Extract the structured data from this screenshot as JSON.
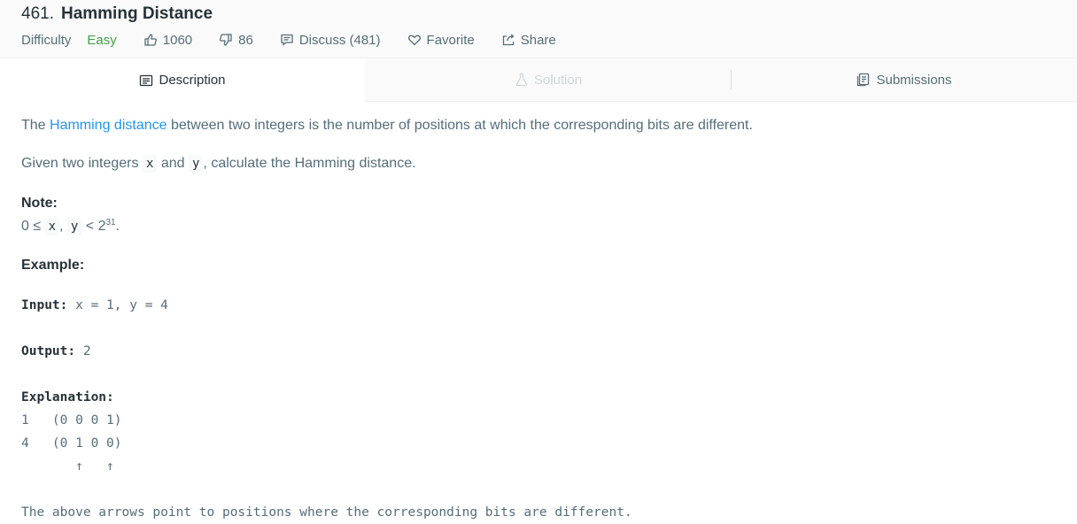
{
  "problem": {
    "number": "461.",
    "title": "Hamming Distance"
  },
  "meta": {
    "difficulty_label": "Difficulty",
    "difficulty_value": "Easy",
    "likes": "1060",
    "dislikes": "86",
    "discuss": "Discuss (481)",
    "favorite": "Favorite",
    "share": "Share"
  },
  "tabs": {
    "description": "Description",
    "solution": "Solution",
    "submissions": "Submissions"
  },
  "description": {
    "p1_pre": "The ",
    "p1_link": "Hamming distance",
    "p1_post": " between two integers is the number of positions at which the corresponding bits are different.",
    "p2_pre": "Given two integers ",
    "p2_x": "x",
    "p2_and": " and ",
    "p2_y": "y",
    "p2_post": ", calculate the Hamming distance.",
    "note_heading": "Note:",
    "note_pre": "0 ≤ ",
    "note_x": "x",
    "note_comma": ", ",
    "note_y": "y",
    "note_lt": " < 2",
    "note_exp": "31",
    "note_end": ".",
    "example_heading": "Example:"
  },
  "example": {
    "input_label": "Input:",
    "input_value": " x = 1, y = 4",
    "output_label": "Output:",
    "output_value": " 2",
    "explanation_label": "Explanation:",
    "line1": "1   (0 0 0 1)",
    "line2": "4   (0 1 0 0)",
    "line3": "       ↑   ↑",
    "footer": "The above arrows point to positions where the corresponding bits are different."
  },
  "colors": {
    "easy": "#43a047",
    "link": "#2196f3"
  }
}
